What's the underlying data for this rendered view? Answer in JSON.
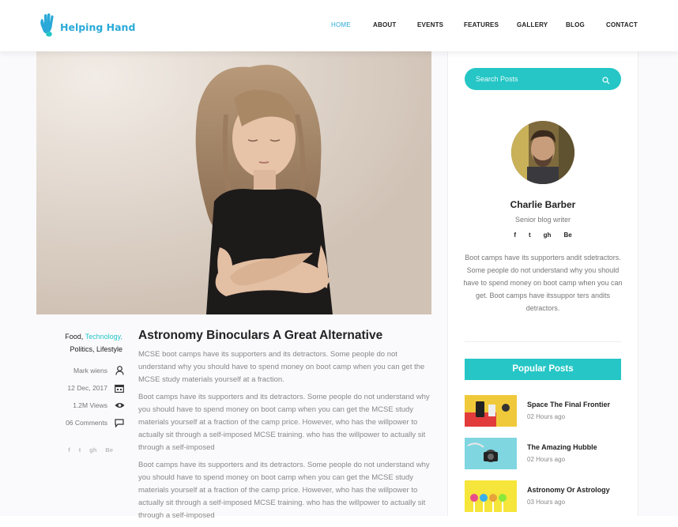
{
  "header": {
    "logo_text": "Helping Hand",
    "nav": [
      "HOME",
      "ABOUT",
      "EVENTS",
      "FEATURES",
      "GALLERY",
      "BLOG",
      "CONTACT"
    ],
    "active_nav": "HOME"
  },
  "sidebar": {
    "search_placeholder": "Search Posts",
    "author": {
      "name": "Charlie Barber",
      "role": "Senior blog writer",
      "social": [
        "f",
        "t",
        "gh",
        "Be"
      ],
      "bio": "Boot camps have its supporters andit sdetractors. Some people do not understand why you should have to spend money on boot camp when you can get. Boot camps have itssuppor ters andits detractors."
    },
    "popular_title": "Popular Posts",
    "posts": [
      {
        "title": "Space The Final Frontier",
        "time": "02 Hours ago"
      },
      {
        "title": "The Amazing Hubble",
        "time": "02 Hours ago"
      },
      {
        "title": "Astronomy Or Astrology",
        "time": "03 Hours ago"
      }
    ]
  },
  "post": {
    "categories": {
      "c1": "Food,",
      "c2": "Technology,",
      "c3": "Politics,",
      "c4": "Lifestyle"
    },
    "author": "Mark wiens",
    "date": "12 Dec, 2017",
    "views": "1.2M Views",
    "comments": "06 Comments",
    "social": [
      "f",
      "t",
      "gh",
      "Be"
    ],
    "title": "Astronomy Binoculars A Great Alternative",
    "paragraphs": [
      "MCSE boot camps have its supporters and its detractors. Some people do not understand why you should have to spend money on boot camp when you can get the MCSE study materials yourself at a fraction.",
      "Boot camps have its supporters and its detractors. Some people do not understand why you should have to spend money on boot camp when you can get the MCSE study materials yourself at a fraction of the camp price. However, who has the willpower to actually sit through a self-imposed MCSE training. who has the willpower to actually sit through a self-imposed",
      "Boot camps have its supporters and its detractors. Some people do not understand why you should have to spend money on boot camp when you can get the MCSE study materials yourself at a fraction of the camp price. However, who has the willpower to actually sit through a self-imposed MCSE training. who has the willpower to actually sit through a self-imposed"
    ]
  },
  "colors": {
    "accent": "#26c6c6",
    "logo": "#2aa9d8"
  }
}
